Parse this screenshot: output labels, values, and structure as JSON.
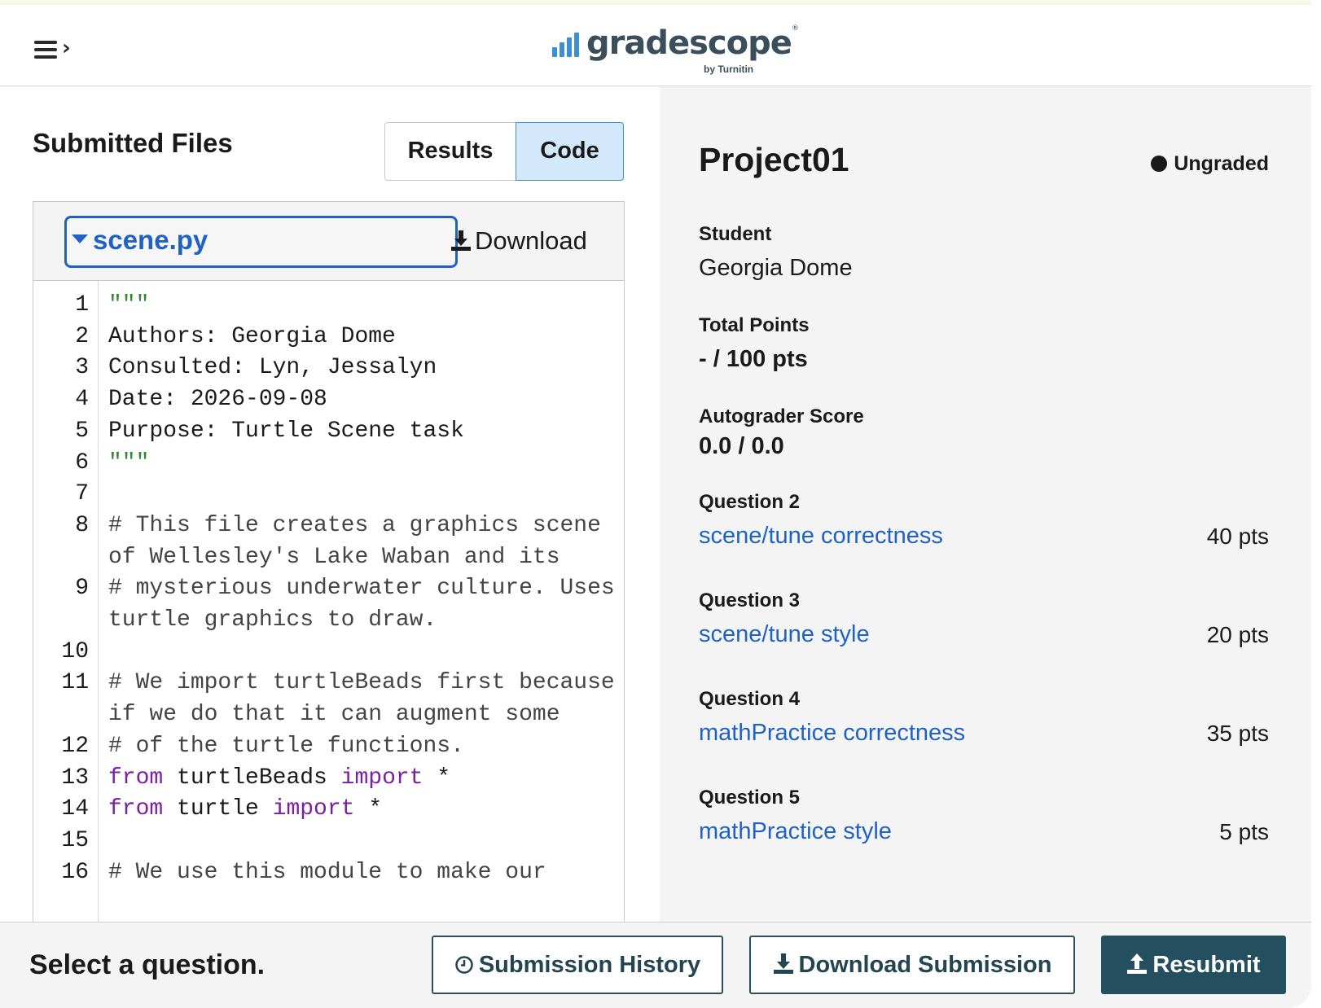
{
  "header": {
    "logo_word": "gradescope",
    "logo_tag": "by Turnitin",
    "menu_icon": "hamburger-menu-icon"
  },
  "left": {
    "title": "Submitted Files",
    "tabs": {
      "results": "Results",
      "code": "Code",
      "active": "Code"
    },
    "file": {
      "name": "scene.py",
      "download_label": "Download"
    },
    "code_lines": [
      {
        "n": "1",
        "parts": [
          [
            "str",
            "\"\"\""
          ]
        ]
      },
      {
        "n": "2",
        "parts": [
          [
            "",
            "Authors: Georgia Dome"
          ]
        ]
      },
      {
        "n": "3",
        "parts": [
          [
            "",
            "Consulted: Lyn, Jessalyn"
          ]
        ]
      },
      {
        "n": "4",
        "parts": [
          [
            "",
            "Date: 2026-09-08"
          ]
        ]
      },
      {
        "n": "5",
        "parts": [
          [
            "",
            "Purpose: Turtle Scene task"
          ]
        ]
      },
      {
        "n": "6",
        "parts": [
          [
            "str",
            "\"\"\""
          ]
        ]
      },
      {
        "n": "7",
        "parts": []
      },
      {
        "n": "8",
        "parts": [
          [
            "cmt",
            "# This file creates a graphics scene"
          ]
        ],
        "wrap": [
          [
            "cmt",
            "of Wellesley's Lake Waban and its"
          ]
        ]
      },
      {
        "n": "9",
        "parts": [
          [
            "cmt",
            "# mysterious underwater culture. Uses"
          ]
        ],
        "wrap": [
          [
            "cmt",
            "turtle graphics to draw."
          ]
        ]
      },
      {
        "n": "10",
        "parts": []
      },
      {
        "n": "11",
        "parts": [
          [
            "cmt",
            "# We import turtleBeads first because"
          ]
        ],
        "wrap": [
          [
            "cmt",
            "if we do that it can augment some"
          ]
        ]
      },
      {
        "n": "12",
        "parts": [
          [
            "cmt",
            "# of the turtle functions."
          ]
        ]
      },
      {
        "n": "13",
        "parts": [
          [
            "kw",
            "from"
          ],
          [
            "",
            " turtleBeads "
          ],
          [
            "kw",
            "import"
          ],
          [
            "",
            " *"
          ]
        ]
      },
      {
        "n": "14",
        "parts": [
          [
            "kw",
            "from"
          ],
          [
            "",
            " turtle "
          ],
          [
            "kw",
            "import"
          ],
          [
            "",
            " *"
          ]
        ]
      },
      {
        "n": "15",
        "parts": []
      },
      {
        "n": "16",
        "parts": [
          [
            "cmt",
            "# We use this module to make our"
          ]
        ]
      }
    ]
  },
  "right": {
    "title": "Project01",
    "status": "Ungraded",
    "student_label": "Student",
    "student_name": "Georgia Dome",
    "total_label": "Total Points",
    "total_value": "- / 100 pts",
    "autograder_label": "Autograder Score",
    "autograder_value": "0.0 / 0.0",
    "questions": [
      {
        "label": "Question 2",
        "title": "scene/tune correctness",
        "points": "40 pts"
      },
      {
        "label": "Question 3",
        "title": "scene/tune style",
        "points": "20 pts"
      },
      {
        "label": "Question 4",
        "title": "mathPractice correctness",
        "points": "35 pts"
      },
      {
        "label": "Question 5",
        "title": "mathPractice style",
        "points": "5 pts"
      }
    ]
  },
  "footer": {
    "prompt": "Select a question.",
    "history": "Submission History",
    "download": "Download Submission",
    "resubmit": "Resubmit"
  },
  "colors": {
    "link": "#1f62c4",
    "accent_dark": "#234f5e",
    "code_tab_bg": "#d3e9fb",
    "string": "#2e8b2e",
    "keyword": "#7a1fa2"
  }
}
